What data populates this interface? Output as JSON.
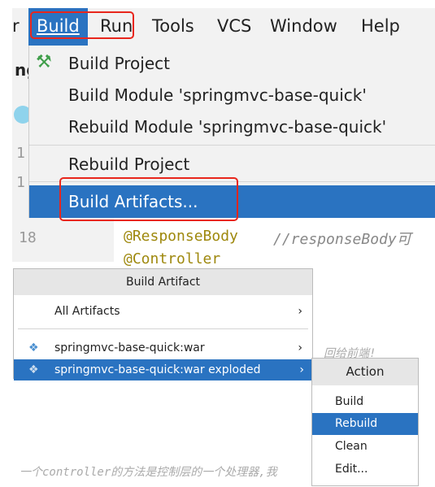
{
  "menubar": {
    "partial_left": "r",
    "items": [
      "Build",
      "Run",
      "Tools",
      "VCS",
      "Window",
      "Help"
    ]
  },
  "build_menu": {
    "items": [
      "Build Project",
      "Build Module 'springmvc-base-quick'",
      "Rebuild Module 'springmvc-base-quick'",
      "Rebuild Project",
      "Build Artifacts..."
    ]
  },
  "editor": {
    "line_number": "18",
    "gutter": [
      "1",
      "1"
    ],
    "annotation": "@ResponseBody",
    "comment": "//responseBody可",
    "next_line": "@Controller",
    "side_tab": "ng",
    "below_text": "回给前端!",
    "bottom_text": "一个controller的方法是控制层的一个处理器,我"
  },
  "build_artifact_popup": {
    "title": "Build Artifact",
    "items": [
      {
        "label": "All Artifacts"
      },
      {
        "label": "springmvc-base-quick:war"
      },
      {
        "label": "springmvc-base-quick:war exploded"
      }
    ]
  },
  "action_popup": {
    "title": "Action",
    "items": [
      "Build",
      "Rebuild",
      "Clean",
      "Edit..."
    ]
  },
  "colors": {
    "selection": "#2a73c1",
    "highlight_box": "#e8261c",
    "menu_bg": "#f2f2f2"
  }
}
